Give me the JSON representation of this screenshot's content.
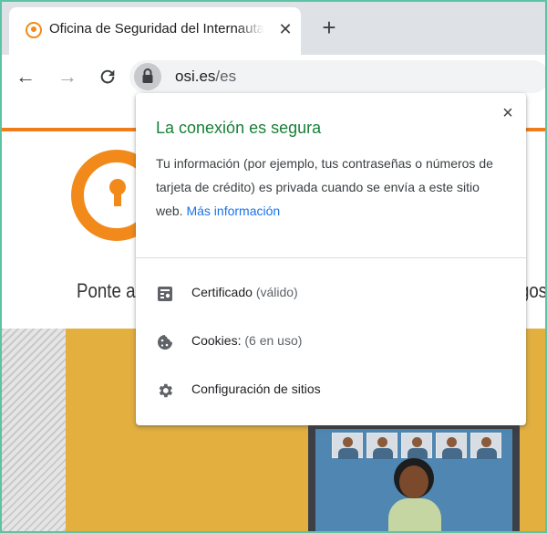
{
  "browser": {
    "tab": {
      "title": "Oficina de Seguridad del Internauta",
      "close_icon": "close-icon"
    },
    "new_tab_label": "+",
    "toolbar": {
      "back_icon": "←",
      "forward_icon": "→",
      "reload_icon": "C",
      "url_domain": "osi.es",
      "url_path": "/es"
    }
  },
  "page": {
    "tagline_left": "Ponte a",
    "tagline_right": "gos"
  },
  "popup": {
    "title": "La conexión es segura",
    "description": "Tu información (por ejemplo, tus contraseñas o números de tarjeta de crédito) es privada cuando se envía a este sitio web.",
    "link": "Más información",
    "close_label": "×",
    "items": [
      {
        "label": "Certificado",
        "sub": "(válido)",
        "icon": "certificate-icon"
      },
      {
        "label": "Cookies:",
        "sub": "(6 en uso)",
        "icon": "cookie-icon"
      },
      {
        "label": "Configuración de sitios",
        "sub": "",
        "icon": "gear-icon"
      }
    ]
  },
  "colors": {
    "secure_green": "#188038",
    "link_blue": "#1a73e8",
    "brand_orange": "#f28a1b",
    "frame_teal": "#5ec3a4",
    "hero_yellow": "#e3b040"
  }
}
